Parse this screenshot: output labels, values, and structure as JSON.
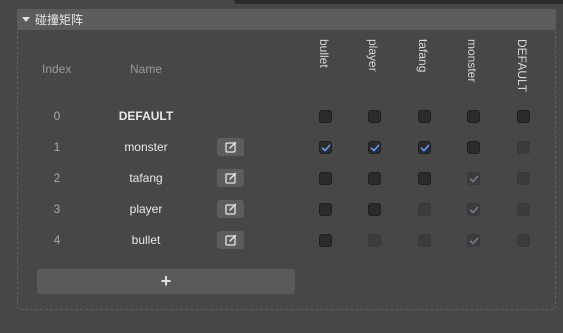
{
  "panel": {
    "title": "碰撞矩阵",
    "add_label": "+"
  },
  "headers": {
    "index": "Index",
    "name": "Name"
  },
  "columns": [
    "bullet",
    "player",
    "tafang",
    "monster",
    "DEFAULT"
  ],
  "rows": [
    {
      "index": "0",
      "name": "DEFAULT",
      "editable": false,
      "cells": [
        "off",
        "off",
        "off",
        "off",
        "off"
      ]
    },
    {
      "index": "1",
      "name": "monster",
      "editable": true,
      "cells": [
        "on",
        "on",
        "on",
        "off",
        "disabled"
      ]
    },
    {
      "index": "2",
      "name": "tafang",
      "editable": true,
      "cells": [
        "off",
        "off",
        "off",
        "disabled-on",
        "disabled"
      ]
    },
    {
      "index": "3",
      "name": "player",
      "editable": true,
      "cells": [
        "off",
        "off",
        "disabled",
        "disabled-on",
        "disabled"
      ]
    },
    {
      "index": "4",
      "name": "bullet",
      "editable": true,
      "cells": [
        "off",
        "disabled",
        "disabled",
        "disabled-on",
        "disabled"
      ]
    }
  ],
  "colors": {
    "check_active": "#5aa0ff",
    "check_disabled": "#6f7d8c"
  },
  "icons": {
    "edit": "edit-icon",
    "expand": "caret-down-icon"
  }
}
